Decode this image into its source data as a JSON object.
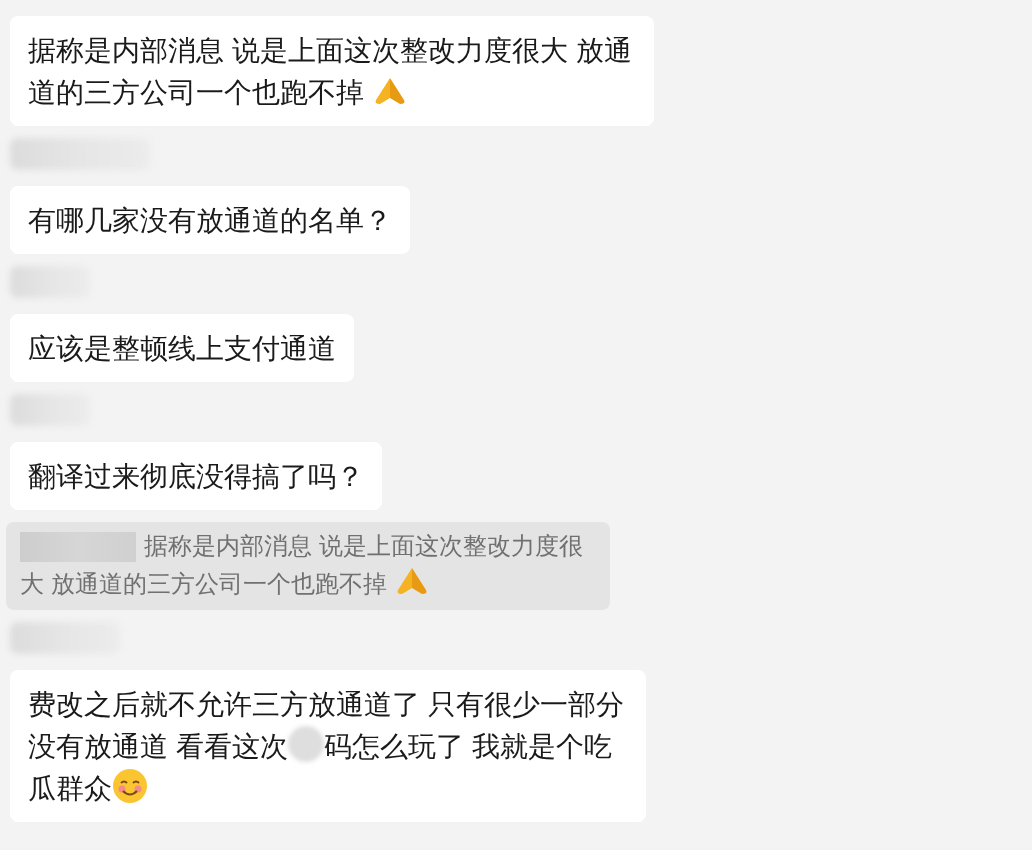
{
  "messages": [
    {
      "kind": "bubble",
      "text": "据称是内部消息 说是上面这次整改力度很大 放通道的三方公司一个也跑不掉",
      "emoji": {
        "kind": "hands"
      },
      "sender_blurred": false
    },
    {
      "kind": "bubble",
      "text": "有哪几家没有放通道的名单？",
      "sender_blurred": true
    },
    {
      "kind": "bubble",
      "text": "应该是整顿线上支付通道",
      "sender_blurred": true
    },
    {
      "kind": "bubble",
      "text": "翻译过来彻底没得搞了吗？",
      "sender_blurred": true
    },
    {
      "kind": "quote",
      "text": "据称是内部消息 说是上面这次整改力度很大 放通道的三方公司一个也跑不掉",
      "emoji": {
        "kind": "hands"
      }
    },
    {
      "kind": "bubble",
      "parts": [
        "费改之后就不允许三方放通道了 只有很少一部分没有放通道  看看这次",
        "码怎么玩了 我就是个吃瓜群众"
      ],
      "emoji": {
        "kind": "smile"
      },
      "sender_blurred": true
    }
  ]
}
